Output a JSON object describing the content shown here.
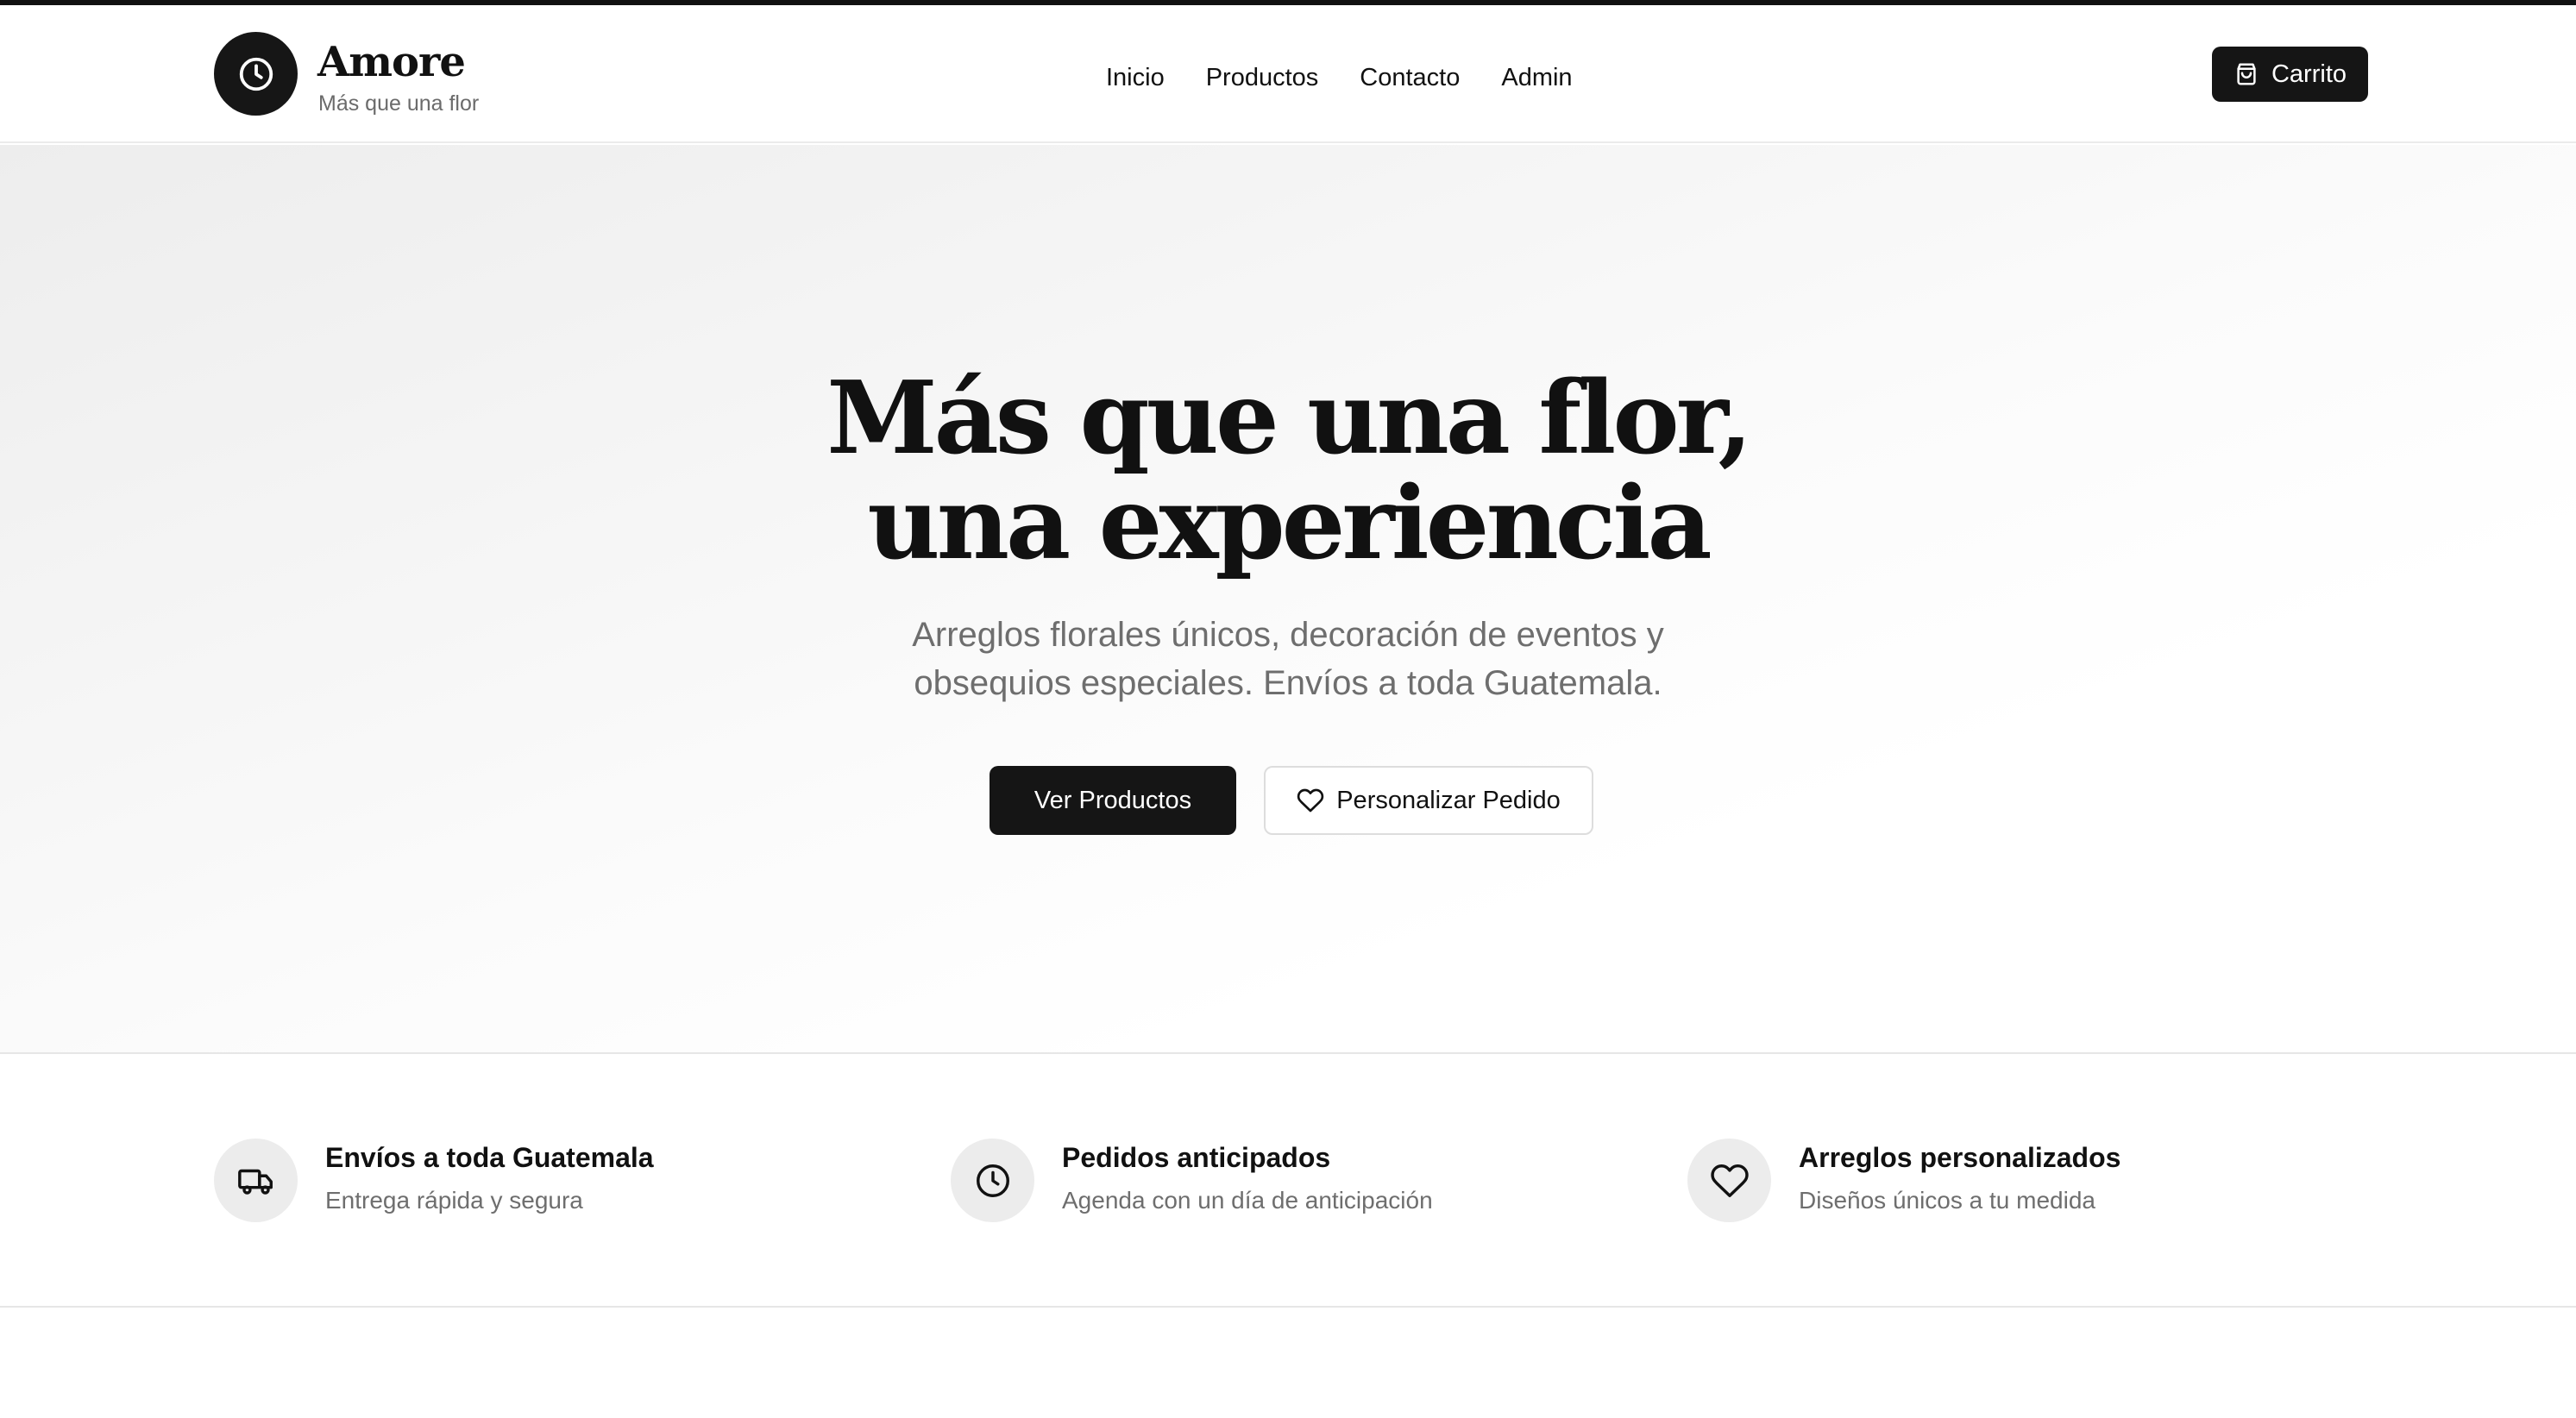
{
  "header": {
    "brand_name": "Amore",
    "brand_tagline": "Más que una flor",
    "nav": [
      "Inicio",
      "Productos",
      "Contacto",
      "Admin"
    ],
    "cart_label": "Carrito"
  },
  "hero": {
    "title_line1": "Más que una flor,",
    "title_line2": "una experiencia",
    "subtitle_line1": "Arreglos florales únicos, decoración de eventos y",
    "subtitle_line2": "obsequios especiales. Envíos a toda Guatemala.",
    "primary_button": "Ver Productos",
    "secondary_button": "Personalizar Pedido"
  },
  "features": [
    {
      "icon": "truck-icon",
      "title": "Envíos a toda Guatemala",
      "description": "Entrega rápida y segura"
    },
    {
      "icon": "clock-icon",
      "title": "Pedidos anticipados",
      "description": "Agenda con un día de anticipación"
    },
    {
      "icon": "heart-icon",
      "title": "Arreglos personalizados",
      "description": "Diseños únicos a tu medida"
    }
  ],
  "colors": {
    "primary": "#151515",
    "muted_text": "#6e6e6e",
    "icon_background": "#ececec"
  }
}
